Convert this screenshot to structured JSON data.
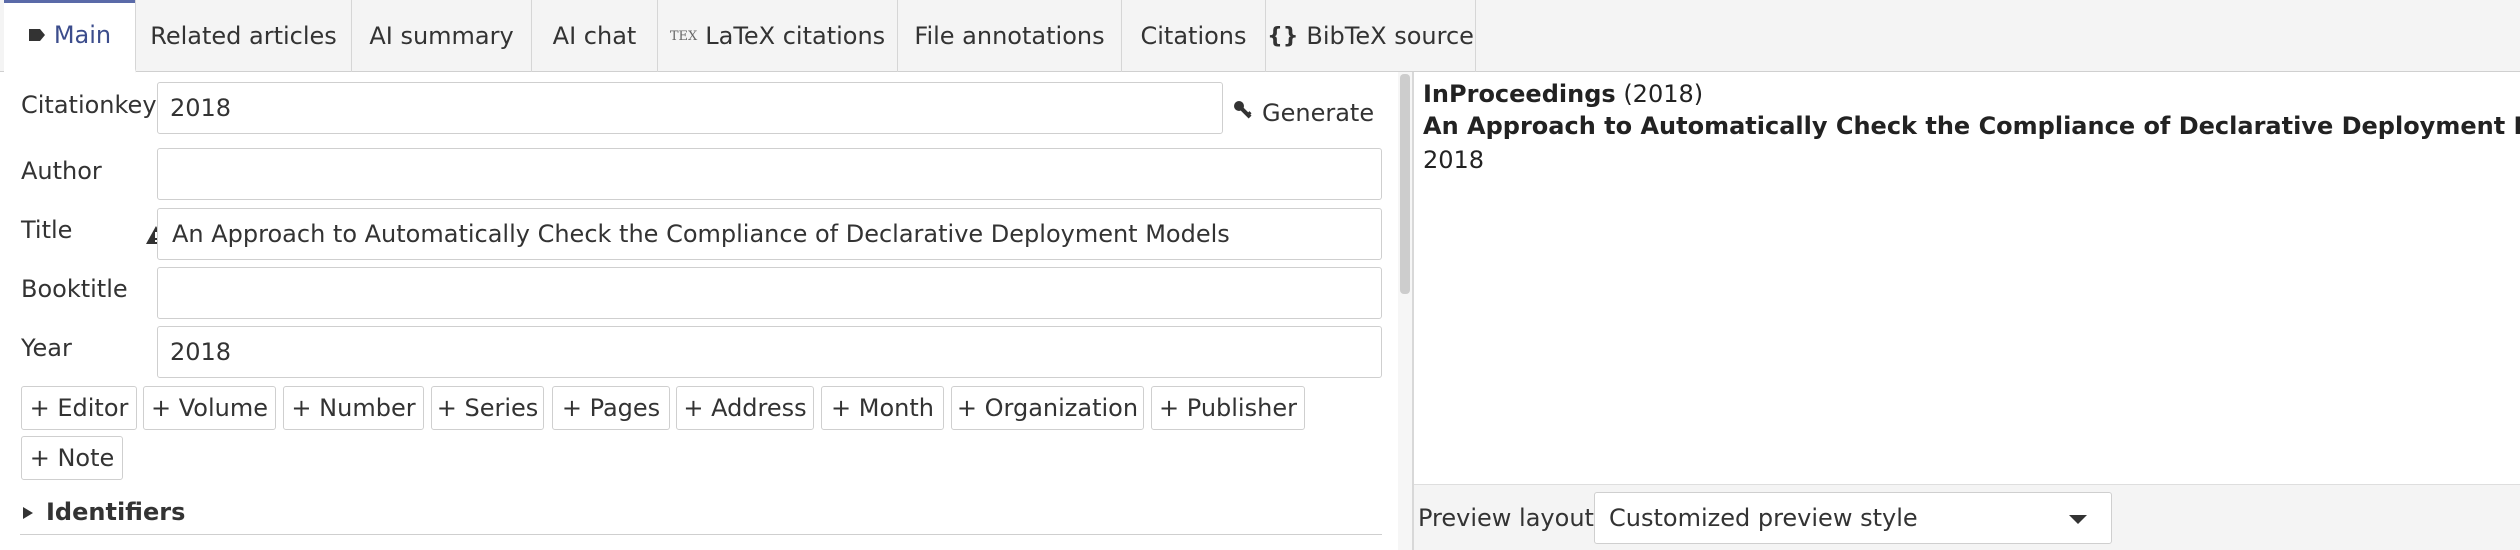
{
  "tabs": [
    {
      "label": "Main",
      "icon": "tag-icon"
    },
    {
      "label": "Related articles"
    },
    {
      "label": "AI summary"
    },
    {
      "label": "AI chat"
    },
    {
      "label": "LaTeX citations",
      "icon": "tex-icon",
      "icon_text": "TEX"
    },
    {
      "label": "File annotations"
    },
    {
      "label": "Citations"
    },
    {
      "label": "BibTeX source",
      "icon": "braces-icon",
      "icon_text": "{}"
    }
  ],
  "fields": {
    "citationkey": {
      "label": "Citationkey",
      "value": "2018"
    },
    "author": {
      "label": "Author",
      "value": ""
    },
    "title": {
      "label": "Title",
      "value": "An Approach to Automatically Check the Compliance of Declarative Deployment Models"
    },
    "booktitle": {
      "label": "Booktitle",
      "value": ""
    },
    "year": {
      "label": "Year",
      "value": "2018"
    }
  },
  "generate_label": "Generate",
  "add_buttons": [
    "+ Editor",
    "+ Volume",
    "+ Number",
    "+ Series",
    "+ Pages",
    "+ Address",
    "+ Month",
    "+ Organization",
    "+ Publisher",
    "+ Note"
  ],
  "identifiers_label": "Identifiers",
  "preview": {
    "entry_type": "InProceedings",
    "entry_year_paren": "(2018)",
    "title": "An Approach to Automatically Check the Compliance of Declarative Deployment Models",
    "year": "2018",
    "layout_label": "Preview layout",
    "layout_value": "Customized preview style"
  },
  "colors": {
    "active_tab_text": "#3c4d8c",
    "tab_bar_bg": "#f4f4f4",
    "border": "#cfcfcf"
  }
}
